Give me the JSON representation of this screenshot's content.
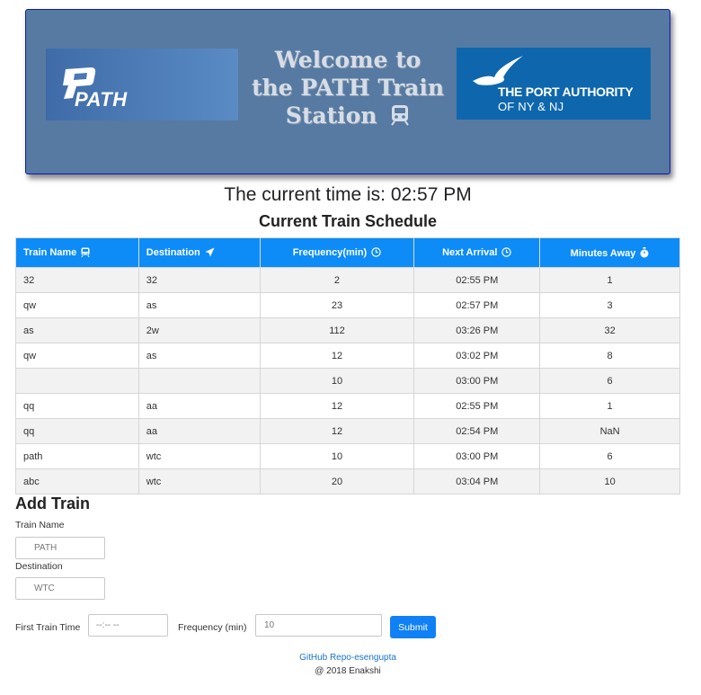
{
  "header": {
    "path_logo_text": "PATH",
    "welcome_text": "Welcome to the PATH Train Station",
    "port_authority_line1": "THE PORT AUTHORITY",
    "port_authority_line2": "OF NY & NJ"
  },
  "clock": {
    "text": "The current time is: 02:57 PM"
  },
  "schedule": {
    "title": "Current Train Schedule",
    "columns": [
      "Train Name",
      "Destination",
      "Frequency(min)",
      "Next Arrival",
      "Minutes Away"
    ],
    "column_icons": [
      "train-icon",
      "paper-plane-icon",
      "clock-icon",
      "clock-icon",
      "stopwatch-icon"
    ],
    "rows": [
      [
        "32",
        "32",
        "2",
        "02:55 PM",
        "1"
      ],
      [
        "qw",
        "as",
        "23",
        "02:57 PM",
        "3"
      ],
      [
        "as",
        "2w",
        "112",
        "03:26 PM",
        "32"
      ],
      [
        "qw",
        "as",
        "12",
        "03:02 PM",
        "8"
      ],
      [
        "",
        "",
        "10",
        "03:00 PM",
        "6"
      ],
      [
        "qq",
        "aa",
        "12",
        "02:55 PM",
        "1"
      ],
      [
        "qq",
        "aa",
        "12",
        "02:54 PM",
        "NaN"
      ],
      [
        "path",
        "wtc",
        "10",
        "03:00 PM",
        "6"
      ],
      [
        "abc",
        "wtc",
        "20",
        "03:04 PM",
        "10"
      ]
    ]
  },
  "form": {
    "title": "Add Train",
    "train_name_label": "Train Name",
    "train_name_placeholder": "PATH",
    "destination_label": "Destination",
    "destination_placeholder": "WTC",
    "first_train_label": "First Train Time",
    "first_train_placeholder": "--:-- --",
    "frequency_label": "Frequency (min)",
    "frequency_placeholder": "10",
    "submit_label": "Submit"
  },
  "footer": {
    "link_text": "GitHub Repo-esengupta",
    "copyright": "@ 2018 Enakshi"
  },
  "colors": {
    "jumbotron": "#567aa2",
    "table_header": "#0d8cf7",
    "submit": "#1081f5",
    "port_authority": "#0e67ad"
  }
}
